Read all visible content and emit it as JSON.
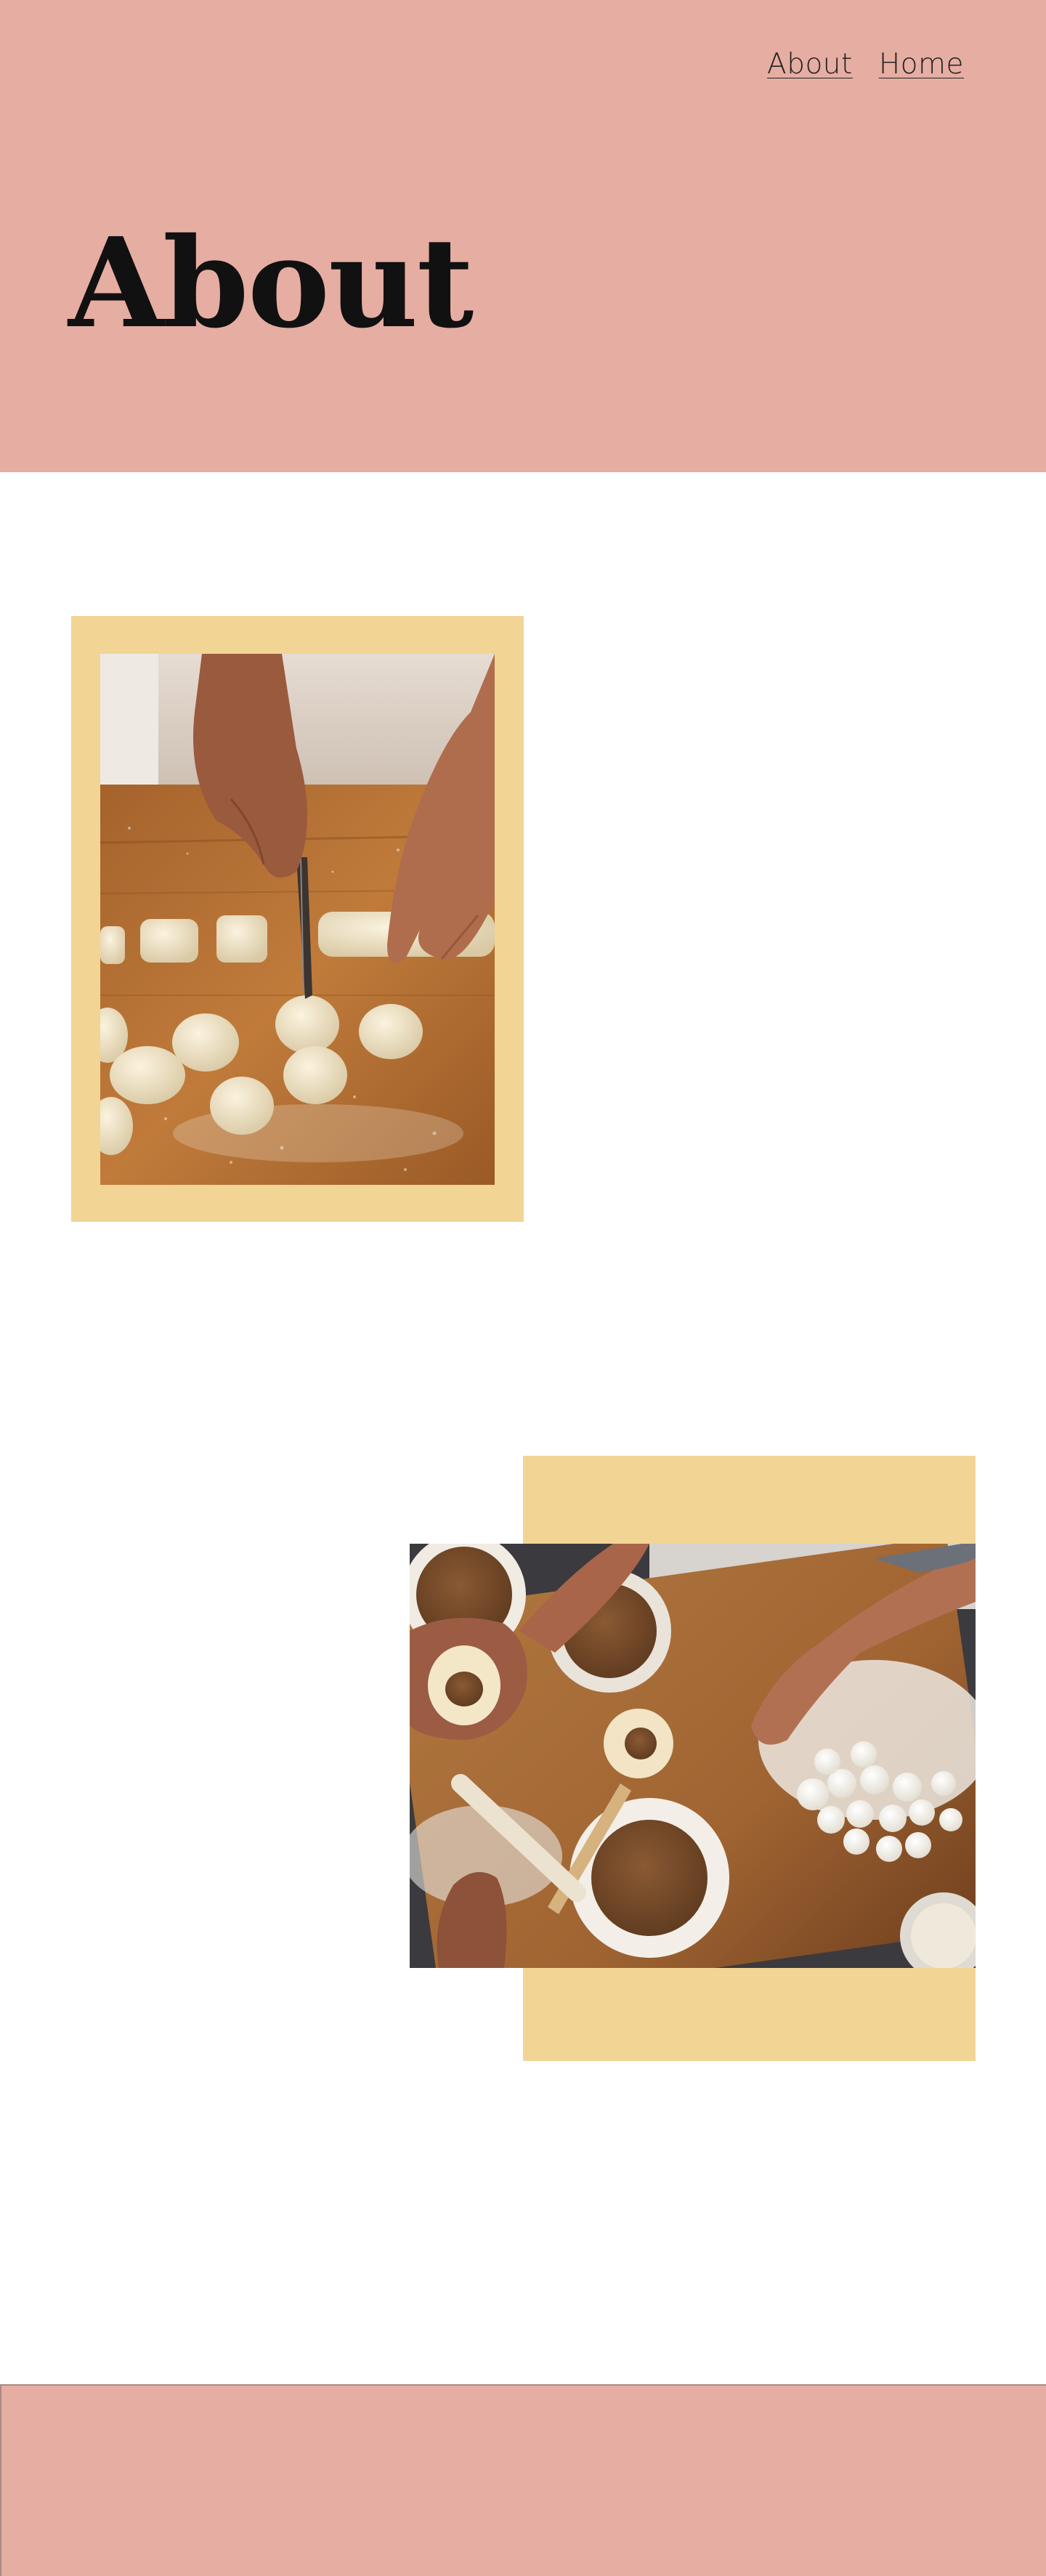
{
  "nav": {
    "links": [
      {
        "label": "About"
      },
      {
        "label": "Home"
      }
    ]
  },
  "page": {
    "title": "About"
  },
  "images": [
    {
      "subject": "hands cutting dough into pieces on floured wooden board"
    },
    {
      "subject": "hands filling dumpling wrappers with meat filling beside bowls and dough balls"
    }
  ],
  "colors": {
    "header_bg": "#e6ada2",
    "frame_accent": "#f2d594",
    "footer_bg": "#e6ada2"
  }
}
